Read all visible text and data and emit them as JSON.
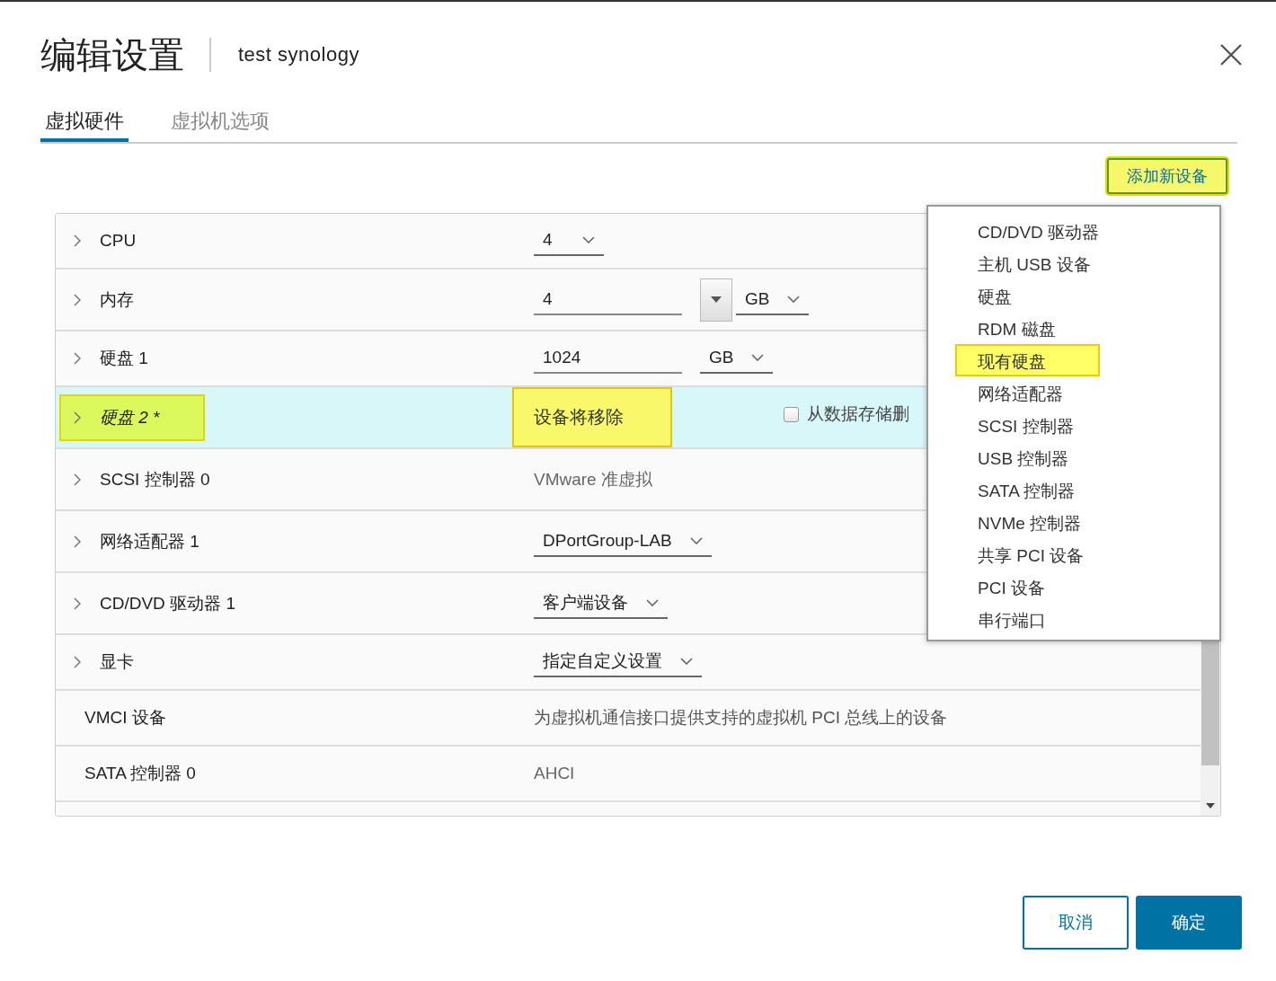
{
  "dialog": {
    "title": "编辑设置",
    "subtitle": "test synology"
  },
  "tabs": [
    {
      "label": "虚拟硬件",
      "selected": true
    },
    {
      "label": "虚拟机选项",
      "selected": false
    }
  ],
  "add_device_button": {
    "label": "添加新设备",
    "highlighted": true
  },
  "hardware_rows": [
    {
      "label": "CPU",
      "expandable": true,
      "pending": false,
      "label_highlighted": false,
      "controls": [
        {
          "kind": "select",
          "value": "4"
        }
      ]
    },
    {
      "label": "内存",
      "expandable": true,
      "pending": false,
      "label_highlighted": false,
      "controls": [
        {
          "kind": "input",
          "value": "4"
        },
        {
          "kind": "spinner"
        },
        {
          "kind": "select",
          "value": "GB"
        }
      ]
    },
    {
      "label": "硬盘 1",
      "expandable": true,
      "pending": false,
      "label_highlighted": false,
      "controls": [
        {
          "kind": "input",
          "value": "1024"
        },
        {
          "kind": "select",
          "value": "GB"
        }
      ]
    },
    {
      "label": "硬盘 2 *",
      "expandable": true,
      "pending": true,
      "label_highlighted": true,
      "controls": [
        {
          "kind": "status",
          "value": "设备将移除",
          "highlighted": true
        },
        {
          "kind": "checkbox",
          "label": "从数据存储删",
          "checked": false
        }
      ]
    },
    {
      "label": "SCSI 控制器 0",
      "expandable": true,
      "pending": false,
      "label_highlighted": false,
      "controls": [
        {
          "kind": "text",
          "value": "VMware 准虚拟"
        }
      ]
    },
    {
      "label": "网络适配器 1",
      "expandable": true,
      "pending": false,
      "label_highlighted": false,
      "controls": [
        {
          "kind": "select",
          "value": "DPortGroup-LAB"
        }
      ]
    },
    {
      "label": "CD/DVD 驱动器 1",
      "expandable": true,
      "pending": false,
      "label_highlighted": false,
      "controls": [
        {
          "kind": "select",
          "value": "客户端设备"
        }
      ]
    },
    {
      "label": "显卡",
      "expandable": true,
      "pending": false,
      "label_highlighted": false,
      "controls": [
        {
          "kind": "select",
          "value": "指定自定义设置"
        }
      ]
    },
    {
      "label": "VMCI 设备",
      "expandable": false,
      "pending": false,
      "label_highlighted": false,
      "controls": [
        {
          "kind": "description",
          "value": "为虚拟机通信接口提供支持的虚拟机 PCI 总线上的设备"
        }
      ]
    },
    {
      "label": "SATA 控制器 0",
      "expandable": false,
      "pending": false,
      "label_highlighted": false,
      "controls": [
        {
          "kind": "text",
          "value": "AHCI"
        }
      ]
    }
  ],
  "add_device_menu": {
    "items": [
      {
        "label": "CD/DVD 驱动器",
        "highlighted": false
      },
      {
        "label": "主机 USB 设备",
        "highlighted": false
      },
      {
        "label": "硬盘",
        "highlighted": false
      },
      {
        "label": "RDM 磁盘",
        "highlighted": false
      },
      {
        "label": "现有硬盘",
        "highlighted": true
      },
      {
        "label": "网络适配器",
        "highlighted": false
      },
      {
        "label": "SCSI 控制器",
        "highlighted": false
      },
      {
        "label": "USB 控制器",
        "highlighted": false
      },
      {
        "label": "SATA 控制器",
        "highlighted": false
      },
      {
        "label": "NVMe 控制器",
        "highlighted": false
      },
      {
        "label": "共享 PCI 设备",
        "highlighted": false
      },
      {
        "label": "PCI 设备",
        "highlighted": false
      },
      {
        "label": "串行端口",
        "highlighted": false
      }
    ]
  },
  "footer_buttons": [
    {
      "label": "取消",
      "kind": "secondary"
    },
    {
      "label": "确定",
      "kind": "primary"
    }
  ]
}
